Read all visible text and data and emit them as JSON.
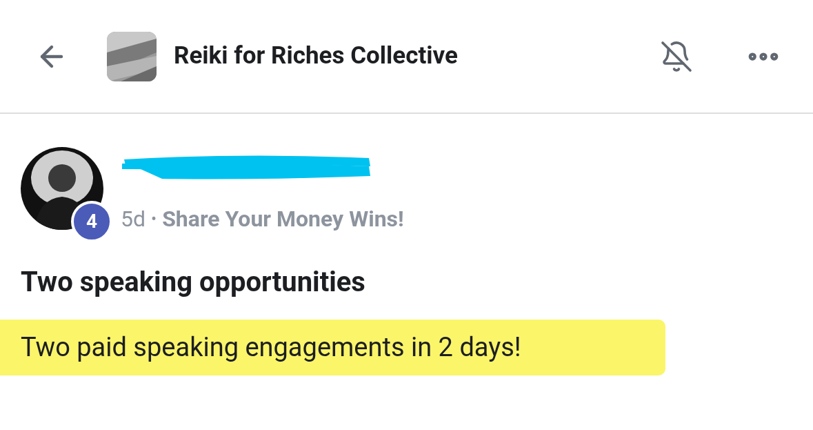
{
  "header": {
    "title": "Reiki for Riches Collective",
    "notifications_muted": true
  },
  "post": {
    "author": {
      "redacted": true
    },
    "badge": "4",
    "time": "5d",
    "separator": "•",
    "topic": "Share Your Money Wins!",
    "title": "Two speaking opportunities",
    "body": "Two paid speaking engagements in 2 days!",
    "body_highlighted": true
  }
}
